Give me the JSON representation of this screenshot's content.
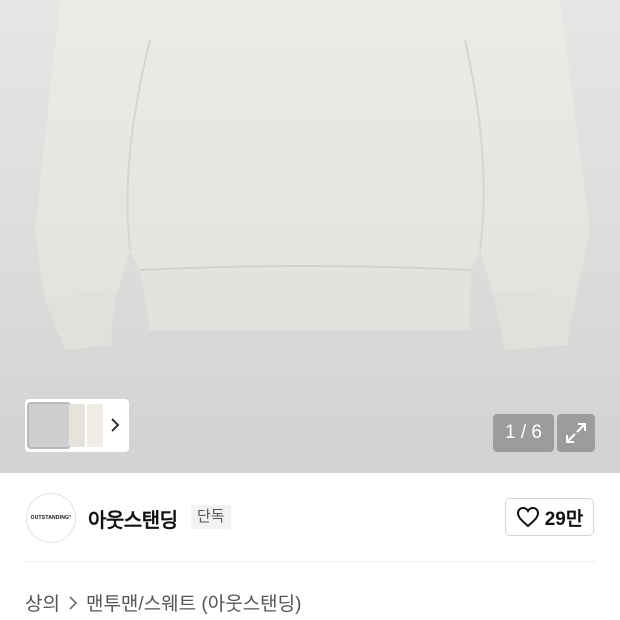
{
  "gallery": {
    "counter": "1 / 6",
    "icons": {
      "thumb_next": "chevron-right-icon",
      "expand": "expand-arrows-icon"
    }
  },
  "brand": {
    "logo_text": "OUTSTANDING°",
    "name": "아웃스탠딩",
    "badge": "단독",
    "like_count": "29만",
    "like_icon": "heart-outline-icon"
  },
  "breadcrumb": {
    "items": [
      "상의",
      "맨투맨/스웨트 (아웃스탠딩)"
    ],
    "separator_icon": "chevron-right-icon"
  }
}
